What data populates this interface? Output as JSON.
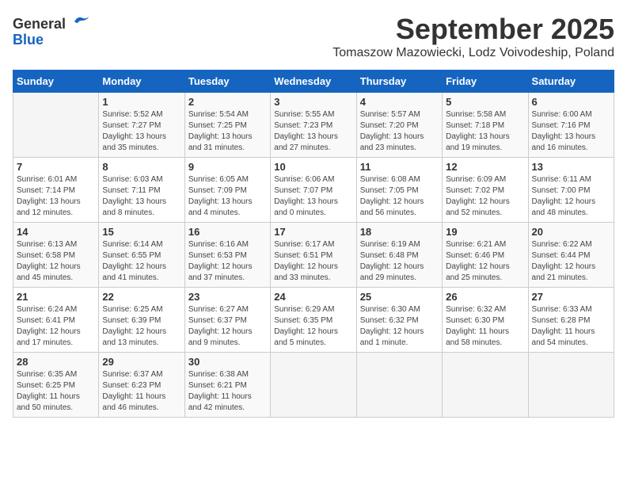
{
  "logo": {
    "line1": "General",
    "line2": "Blue"
  },
  "title": "September 2025",
  "subtitle": "Tomaszow Mazowiecki, Lodz Voivodeship, Poland",
  "days_of_week": [
    "Sunday",
    "Monday",
    "Tuesday",
    "Wednesday",
    "Thursday",
    "Friday",
    "Saturday"
  ],
  "weeks": [
    [
      {
        "day": "",
        "info": ""
      },
      {
        "day": "1",
        "info": "Sunrise: 5:52 AM\nSunset: 7:27 PM\nDaylight: 13 hours\nand 35 minutes."
      },
      {
        "day": "2",
        "info": "Sunrise: 5:54 AM\nSunset: 7:25 PM\nDaylight: 13 hours\nand 31 minutes."
      },
      {
        "day": "3",
        "info": "Sunrise: 5:55 AM\nSunset: 7:23 PM\nDaylight: 13 hours\nand 27 minutes."
      },
      {
        "day": "4",
        "info": "Sunrise: 5:57 AM\nSunset: 7:20 PM\nDaylight: 13 hours\nand 23 minutes."
      },
      {
        "day": "5",
        "info": "Sunrise: 5:58 AM\nSunset: 7:18 PM\nDaylight: 13 hours\nand 19 minutes."
      },
      {
        "day": "6",
        "info": "Sunrise: 6:00 AM\nSunset: 7:16 PM\nDaylight: 13 hours\nand 16 minutes."
      }
    ],
    [
      {
        "day": "7",
        "info": "Sunrise: 6:01 AM\nSunset: 7:14 PM\nDaylight: 13 hours\nand 12 minutes."
      },
      {
        "day": "8",
        "info": "Sunrise: 6:03 AM\nSunset: 7:11 PM\nDaylight: 13 hours\nand 8 minutes."
      },
      {
        "day": "9",
        "info": "Sunrise: 6:05 AM\nSunset: 7:09 PM\nDaylight: 13 hours\nand 4 minutes."
      },
      {
        "day": "10",
        "info": "Sunrise: 6:06 AM\nSunset: 7:07 PM\nDaylight: 13 hours\nand 0 minutes."
      },
      {
        "day": "11",
        "info": "Sunrise: 6:08 AM\nSunset: 7:05 PM\nDaylight: 12 hours\nand 56 minutes."
      },
      {
        "day": "12",
        "info": "Sunrise: 6:09 AM\nSunset: 7:02 PM\nDaylight: 12 hours\nand 52 minutes."
      },
      {
        "day": "13",
        "info": "Sunrise: 6:11 AM\nSunset: 7:00 PM\nDaylight: 12 hours\nand 48 minutes."
      }
    ],
    [
      {
        "day": "14",
        "info": "Sunrise: 6:13 AM\nSunset: 6:58 PM\nDaylight: 12 hours\nand 45 minutes."
      },
      {
        "day": "15",
        "info": "Sunrise: 6:14 AM\nSunset: 6:55 PM\nDaylight: 12 hours\nand 41 minutes."
      },
      {
        "day": "16",
        "info": "Sunrise: 6:16 AM\nSunset: 6:53 PM\nDaylight: 12 hours\nand 37 minutes."
      },
      {
        "day": "17",
        "info": "Sunrise: 6:17 AM\nSunset: 6:51 PM\nDaylight: 12 hours\nand 33 minutes."
      },
      {
        "day": "18",
        "info": "Sunrise: 6:19 AM\nSunset: 6:48 PM\nDaylight: 12 hours\nand 29 minutes."
      },
      {
        "day": "19",
        "info": "Sunrise: 6:21 AM\nSunset: 6:46 PM\nDaylight: 12 hours\nand 25 minutes."
      },
      {
        "day": "20",
        "info": "Sunrise: 6:22 AM\nSunset: 6:44 PM\nDaylight: 12 hours\nand 21 minutes."
      }
    ],
    [
      {
        "day": "21",
        "info": "Sunrise: 6:24 AM\nSunset: 6:41 PM\nDaylight: 12 hours\nand 17 minutes."
      },
      {
        "day": "22",
        "info": "Sunrise: 6:25 AM\nSunset: 6:39 PM\nDaylight: 12 hours\nand 13 minutes."
      },
      {
        "day": "23",
        "info": "Sunrise: 6:27 AM\nSunset: 6:37 PM\nDaylight: 12 hours\nand 9 minutes."
      },
      {
        "day": "24",
        "info": "Sunrise: 6:29 AM\nSunset: 6:35 PM\nDaylight: 12 hours\nand 5 minutes."
      },
      {
        "day": "25",
        "info": "Sunrise: 6:30 AM\nSunset: 6:32 PM\nDaylight: 12 hours\nand 1 minute."
      },
      {
        "day": "26",
        "info": "Sunrise: 6:32 AM\nSunset: 6:30 PM\nDaylight: 11 hours\nand 58 minutes."
      },
      {
        "day": "27",
        "info": "Sunrise: 6:33 AM\nSunset: 6:28 PM\nDaylight: 11 hours\nand 54 minutes."
      }
    ],
    [
      {
        "day": "28",
        "info": "Sunrise: 6:35 AM\nSunset: 6:25 PM\nDaylight: 11 hours\nand 50 minutes."
      },
      {
        "day": "29",
        "info": "Sunrise: 6:37 AM\nSunset: 6:23 PM\nDaylight: 11 hours\nand 46 minutes."
      },
      {
        "day": "30",
        "info": "Sunrise: 6:38 AM\nSunset: 6:21 PM\nDaylight: 11 hours\nand 42 minutes."
      },
      {
        "day": "",
        "info": ""
      },
      {
        "day": "",
        "info": ""
      },
      {
        "day": "",
        "info": ""
      },
      {
        "day": "",
        "info": ""
      }
    ]
  ]
}
